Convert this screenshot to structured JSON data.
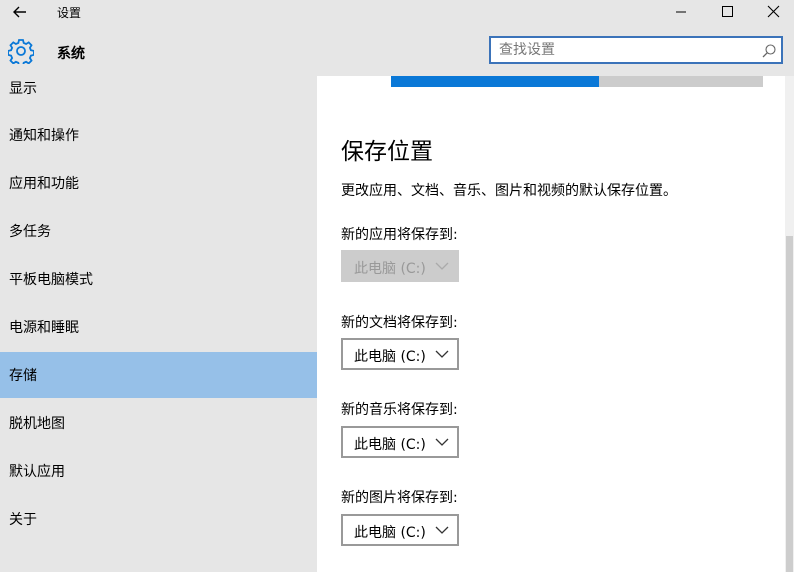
{
  "window": {
    "title": "设置",
    "back_icon": "arrow-left-icon",
    "minimize_icon": "minimize-icon",
    "maximize_icon": "maximize-icon",
    "close_icon": "close-icon"
  },
  "header": {
    "icon": "gear-icon",
    "title": "系统",
    "search_placeholder": "查找设置",
    "search_icon": "search-icon"
  },
  "sidebar": {
    "items": [
      {
        "label": "显示"
      },
      {
        "label": "通知和操作"
      },
      {
        "label": "应用和功能"
      },
      {
        "label": "多任务"
      },
      {
        "label": "平板电脑模式"
      },
      {
        "label": "电源和睡眠"
      },
      {
        "label": "存储",
        "selected": true
      },
      {
        "label": "脱机地图"
      },
      {
        "label": "默认应用"
      },
      {
        "label": "关于"
      }
    ]
  },
  "main": {
    "storage_usage_fraction": 0.56,
    "section_title": "保存位置",
    "description": "更改应用、文档、音乐、图片和视频的默认保存位置。",
    "locations": [
      {
        "label": "新的应用将保存到:",
        "value": "此电脑 (C:)",
        "disabled": true
      },
      {
        "label": "新的文档将保存到:",
        "value": "此电脑 (C:)",
        "disabled": false
      },
      {
        "label": "新的音乐将保存到:",
        "value": "此电脑 (C:)",
        "disabled": false
      },
      {
        "label": "新的图片将保存到:",
        "value": "此电脑 (C:)",
        "disabled": false
      }
    ]
  },
  "colors": {
    "accent": "#0a78d7",
    "selected_nav": "#96c0e8",
    "sidebar_bg": "#e6e6e6"
  }
}
